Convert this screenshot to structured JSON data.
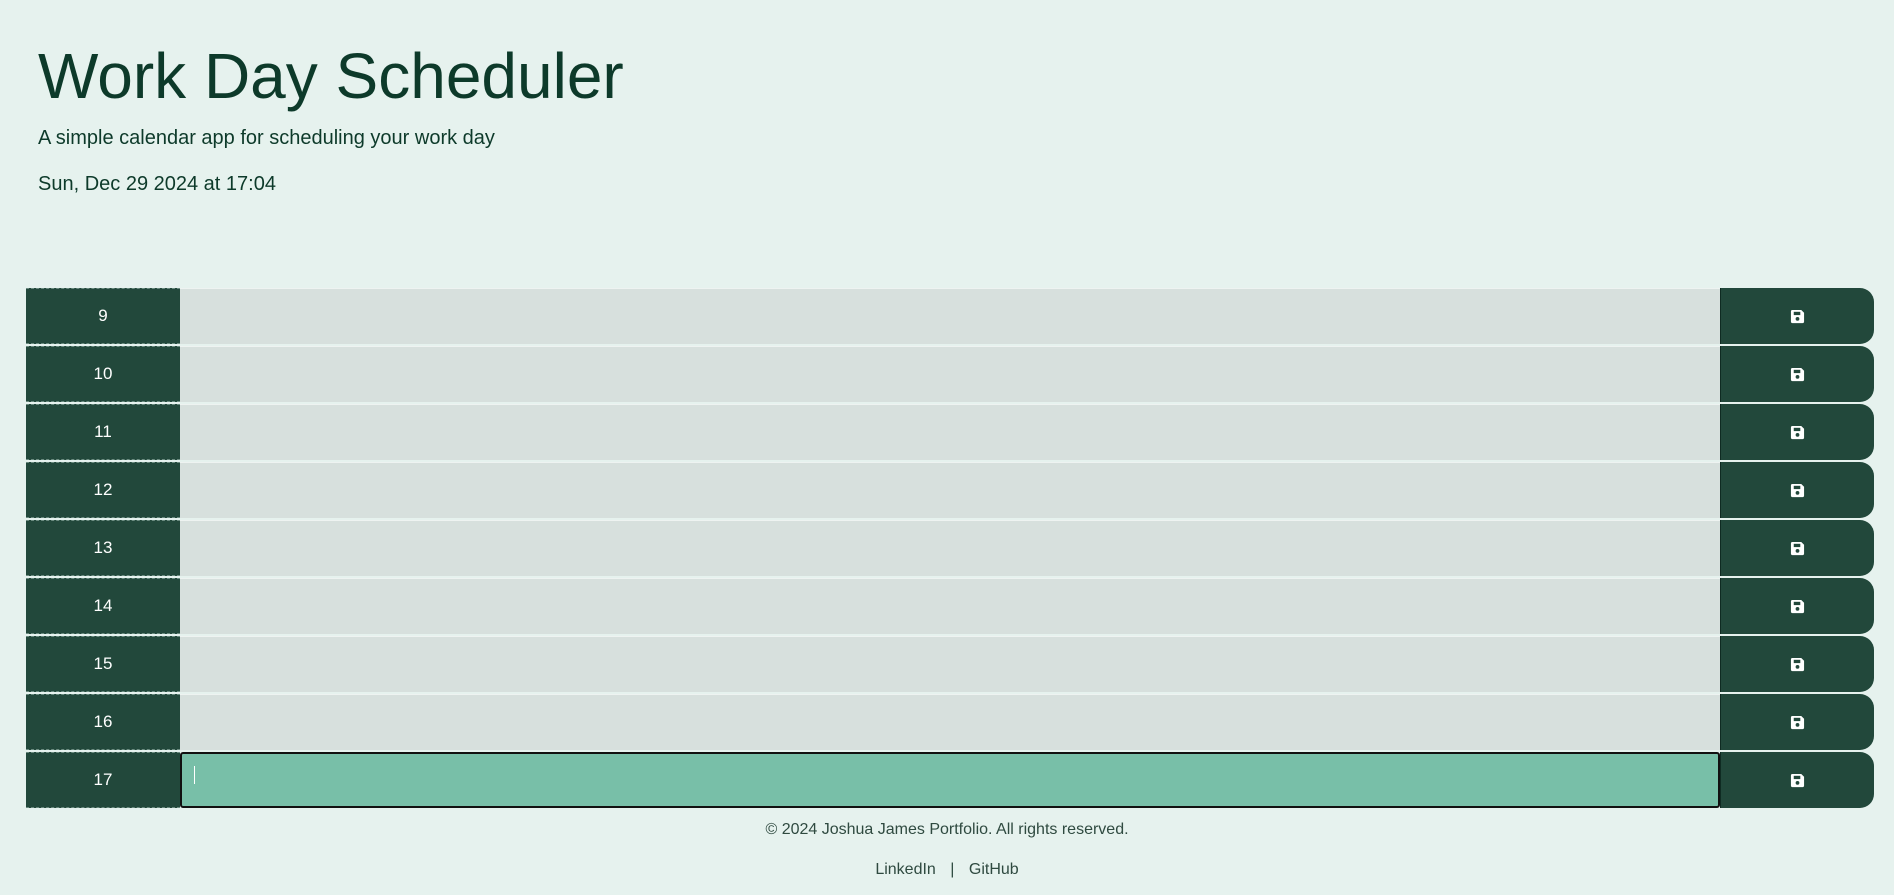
{
  "header": {
    "title": "Work Day Scheduler",
    "subtitle": "A simple calendar app for scheduling your work day",
    "datetime": "Sun, Dec 29 2024 at 17:04"
  },
  "schedule": {
    "rows": [
      {
        "hour": "9",
        "task": "",
        "state": "past"
      },
      {
        "hour": "10",
        "task": "",
        "state": "past"
      },
      {
        "hour": "11",
        "task": "",
        "state": "past"
      },
      {
        "hour": "12",
        "task": "",
        "state": "past"
      },
      {
        "hour": "13",
        "task": "",
        "state": "past"
      },
      {
        "hour": "14",
        "task": "",
        "state": "past"
      },
      {
        "hour": "15",
        "task": "",
        "state": "past"
      },
      {
        "hour": "16",
        "task": "",
        "state": "past"
      },
      {
        "hour": "17",
        "task": "",
        "state": "present"
      }
    ],
    "save_icon": "floppy-disk-icon"
  },
  "footer": {
    "copyright": "© 2024 Joshua James Portfolio. All rights reserved.",
    "linkedin_label": "LinkedIn",
    "separator": "|",
    "github_label": "GitHub"
  },
  "colors": {
    "background": "#e6f2ee",
    "hour_block": "#22483b",
    "past": "#d7e0dd",
    "present": "#78bfa8",
    "text": "#0d3a2a"
  }
}
